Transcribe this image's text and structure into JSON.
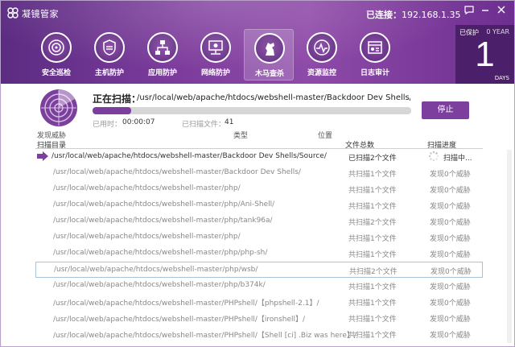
{
  "app": {
    "title": "凝镜管家"
  },
  "header": {
    "connected_label": "已连接：",
    "connected_ip": "192.168.1.35"
  },
  "nav": [
    {
      "label": "安全巡检",
      "icon": "radar-icon",
      "active": false
    },
    {
      "label": "主机防护",
      "icon": "host-shield-icon",
      "active": false
    },
    {
      "label": "应用防护",
      "icon": "app-network-icon",
      "active": false
    },
    {
      "label": "网络防护",
      "icon": "network-icon",
      "active": false
    },
    {
      "label": "木马查杀",
      "icon": "trojan-horse-icon",
      "active": true
    },
    {
      "label": "资源监控",
      "icon": "monitor-pulse-icon",
      "active": false
    },
    {
      "label": "日志审计",
      "icon": "log-audit-icon",
      "active": false
    }
  ],
  "protect": {
    "label": "已保护",
    "year": "0 YEAR",
    "days_value": "1",
    "days_label": "DAYS"
  },
  "scan": {
    "status_label": "正在扫描：",
    "current_path": "/usr/local/web/apache/htdocs/webshell-master/Backdoor Dev Shells/Source/devilzSh",
    "progress": 0.12,
    "elapsed_label": "已用时：",
    "elapsed_value": "00:00:07",
    "files_label": "已扫描文件：",
    "files_value": "41",
    "stop_label": "停止"
  },
  "table": {
    "header_top": {
      "found": "发现威胁",
      "type": "类型",
      "location": "位置"
    },
    "header": {
      "dir": "扫描目录",
      "total": "文件总数",
      "progress": "扫描进度"
    },
    "rows": [
      {
        "path": "/usr/local/web/apache/htdocs/webshell-master/Backdoor Dev Shells/Source/",
        "count": "已扫描2个文件",
        "threat": "扫描中...",
        "current": true
      },
      {
        "path": "/usr/local/web/apache/htdocs/webshell-master/Backdoor Dev Shells/",
        "count": "共扫描1个文件",
        "threat": "发现0个威胁"
      },
      {
        "path": "/usr/local/web/apache/htdocs/webshell-master/php/",
        "count": "共扫描1个文件",
        "threat": "发现0个威胁"
      },
      {
        "path": "/usr/local/web/apache/htdocs/webshell-master/php/Ani-Shell/",
        "count": "共扫描1个文件",
        "threat": "发现0个威胁"
      },
      {
        "path": "/usr/local/web/apache/htdocs/webshell-master/php/tank96a/",
        "count": "共扫描2个文件",
        "threat": "发现0个威胁"
      },
      {
        "path": "/usr/local/web/apache/htdocs/webshell-master/php/",
        "count": "共扫描1个文件",
        "threat": "发现0个威胁"
      },
      {
        "path": "/usr/local/web/apache/htdocs/webshell-master/php/php-sh/",
        "count": "共扫描1个文件",
        "threat": "发现0个威胁"
      },
      {
        "path": "/usr/local/web/apache/htdocs/webshell-master/php/wsb/",
        "count": "共扫描2个文件",
        "threat": "发现0个威胁",
        "selected": true
      },
      {
        "path": "/usr/local/web/apache/htdocs/webshell-master/php/b374k/",
        "count": "共扫描1个文件",
        "threat": "发现0个威胁"
      },
      {
        "path": "/usr/local/web/apache/htdocs/webshell-master/PHPshell/【phpshell-2.1】/",
        "count": "共扫描1个文件",
        "threat": "发现0个威胁"
      },
      {
        "path": "/usr/local/web/apache/htdocs/webshell-master/PHPshell/【ironshell】/",
        "count": "共扫描1个文件",
        "threat": "发现0个威胁"
      },
      {
        "path": "/usr/local/web/apache/htdocs/webshell-master/PHPshell/【Shell [ci] .Biz was here】/",
        "count": "共扫描1个文件",
        "threat": "发现0个威胁"
      }
    ]
  },
  "colors": {
    "accent": "#7c3f9e",
    "header_dark": "#5b2c82",
    "panel_dark": "#4b1f6a"
  }
}
